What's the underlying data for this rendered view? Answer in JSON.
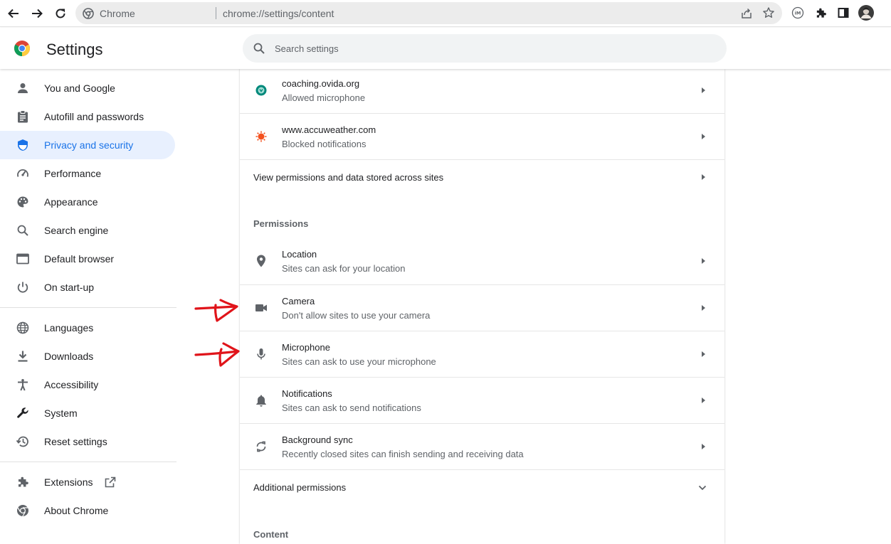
{
  "browser": {
    "origin_label": "Chrome",
    "url": "chrome://settings/content"
  },
  "header": {
    "title": "Settings",
    "search_placeholder": "Search settings"
  },
  "sidebar": {
    "items": [
      {
        "label": "You and Google"
      },
      {
        "label": "Autofill and passwords"
      },
      {
        "label": "Privacy and security"
      },
      {
        "label": "Performance"
      },
      {
        "label": "Appearance"
      },
      {
        "label": "Search engine"
      },
      {
        "label": "Default browser"
      },
      {
        "label": "On start-up"
      },
      {
        "label": "Languages"
      },
      {
        "label": "Downloads"
      },
      {
        "label": "Accessibility"
      },
      {
        "label": "System"
      },
      {
        "label": "Reset settings"
      },
      {
        "label": "Extensions"
      },
      {
        "label": "About Chrome"
      }
    ]
  },
  "main": {
    "recent_sites": [
      {
        "site": "coaching.ovida.org",
        "status": "Allowed microphone"
      },
      {
        "site": "www.accuweather.com",
        "status": "Blocked notifications"
      }
    ],
    "view_permissions": "View permissions and data stored across sites",
    "permissions_heading": "Permissions",
    "permissions": [
      {
        "title": "Location",
        "desc": "Sites can ask for your location",
        "icon": "location-pin-icon"
      },
      {
        "title": "Camera",
        "desc": "Don't allow sites to use your camera",
        "icon": "camera-icon"
      },
      {
        "title": "Microphone",
        "desc": "Sites can ask to use your microphone",
        "icon": "microphone-icon"
      },
      {
        "title": "Notifications",
        "desc": "Sites can ask to send notifications",
        "icon": "bell-icon"
      },
      {
        "title": "Background sync",
        "desc": "Recently closed sites can finish sending and receiving data",
        "icon": "sync-icon"
      }
    ],
    "additional_permissions": "Additional permissions",
    "content_heading": "Content"
  },
  "colors": {
    "accent": "#1a73e8",
    "active_bg": "#e8f0fe",
    "annotation": "#e0141a"
  }
}
